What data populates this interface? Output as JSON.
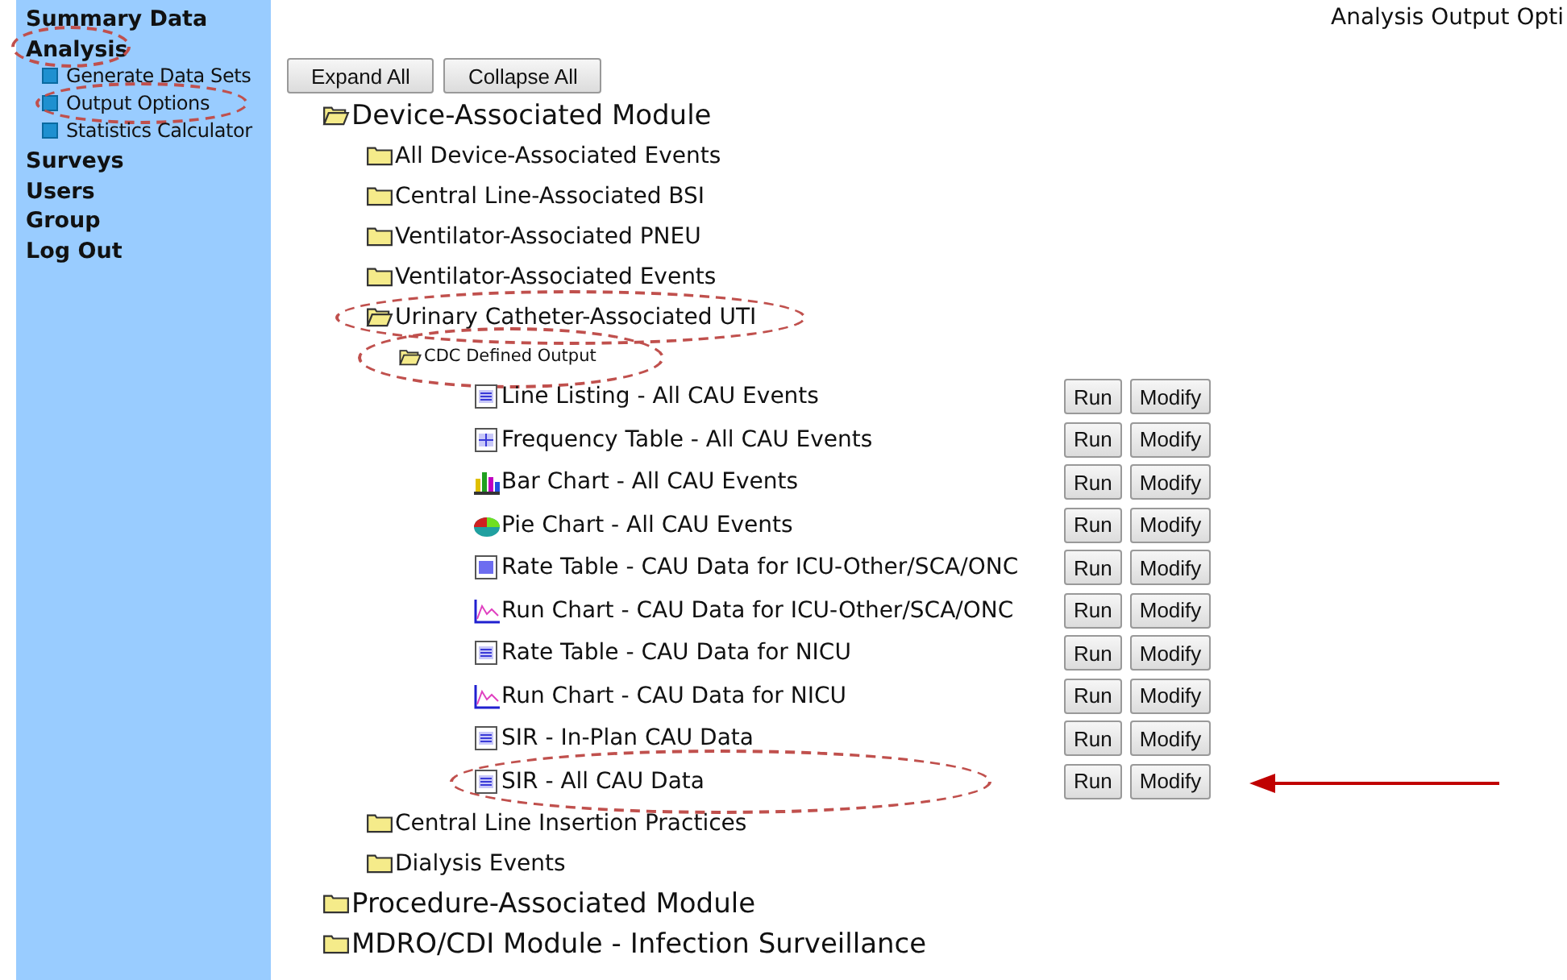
{
  "sidebar": {
    "items": [
      {
        "label": "Summary Data",
        "circled": false
      },
      {
        "label": "Analysis",
        "circled": true,
        "children": [
          {
            "label": "Generate Data Sets",
            "circled": false
          },
          {
            "label": "Output Options",
            "circled": true
          },
          {
            "label": "Statistics Calculator",
            "circled": false
          }
        ]
      },
      {
        "label": "Surveys",
        "circled": false
      },
      {
        "label": "Users",
        "circled": false
      },
      {
        "label": "Group",
        "circled": false
      },
      {
        "label": "Log Out",
        "circled": false
      }
    ]
  },
  "header": {
    "title": "Analysis Output Opti"
  },
  "toolbar": {
    "buttons": [
      "Expand All",
      "Collapse All"
    ]
  },
  "tree": [
    {
      "label": "Device-Associated Module",
      "expanded": true,
      "circled": false,
      "children": [
        {
          "label": "All Device-Associated Events",
          "expanded": false,
          "circled": false
        },
        {
          "label": "Central Line-Associated BSI",
          "expanded": false,
          "circled": false
        },
        {
          "label": "Ventilator-Associated PNEU",
          "expanded": false,
          "circled": false
        },
        {
          "label": "Ventilator-Associated Events",
          "expanded": false,
          "circled": false
        },
        {
          "label": "Urinary Catheter-Associated UTI",
          "expanded": true,
          "circled": true,
          "children": [
            {
              "label": "CDC Defined Output",
              "expanded": true,
              "circled": true,
              "reports": [
                {
                  "kind": "list",
                  "label": "Line Listing - All CAU Events",
                  "run": "Run",
                  "modify": "Modify",
                  "circled": false,
                  "arrow": false
                },
                {
                  "kind": "table",
                  "label": "Frequency Table - All CAU Events",
                  "run": "Run",
                  "modify": "Modify",
                  "circled": false,
                  "arrow": false
                },
                {
                  "kind": "bar",
                  "label": "Bar Chart - All CAU Events",
                  "run": "Run",
                  "modify": "Modify",
                  "circled": false,
                  "arrow": false
                },
                {
                  "kind": "pie",
                  "label": "Pie Chart - All CAU Events",
                  "run": "Run",
                  "modify": "Modify",
                  "circled": false,
                  "arrow": false
                },
                {
                  "kind": "rate",
                  "label": "Rate Table - CAU Data for ICU-Other/SCA/ONC",
                  "run": "Run",
                  "modify": "Modify",
                  "circled": false,
                  "arrow": false
                },
                {
                  "kind": "run",
                  "label": "Run Chart - CAU Data for ICU-Other/SCA/ONC",
                  "run": "Run",
                  "modify": "Modify",
                  "circled": false,
                  "arrow": false
                },
                {
                  "kind": "list",
                  "label": "Rate Table - CAU Data for NICU",
                  "run": "Run",
                  "modify": "Modify",
                  "circled": false,
                  "arrow": false
                },
                {
                  "kind": "run",
                  "label": "Run Chart - CAU Data for NICU",
                  "run": "Run",
                  "modify": "Modify",
                  "circled": false,
                  "arrow": false
                },
                {
                  "kind": "list",
                  "label": "SIR - In-Plan CAU Data",
                  "run": "Run",
                  "modify": "Modify",
                  "circled": false,
                  "arrow": false
                },
                {
                  "kind": "list",
                  "label": "SIR - All CAU Data",
                  "run": "Run",
                  "modify": "Modify",
                  "circled": true,
                  "arrow": true
                }
              ]
            }
          ]
        },
        {
          "label": "Central Line Insertion Practices",
          "expanded": false,
          "circled": false
        },
        {
          "label": "Dialysis Events",
          "expanded": false,
          "circled": false
        }
      ]
    },
    {
      "label": "Procedure-Associated Module",
      "expanded": false,
      "circled": false
    },
    {
      "label": "MDRO/CDI Module - Infection Surveillance",
      "expanded": false,
      "circled": false
    }
  ]
}
